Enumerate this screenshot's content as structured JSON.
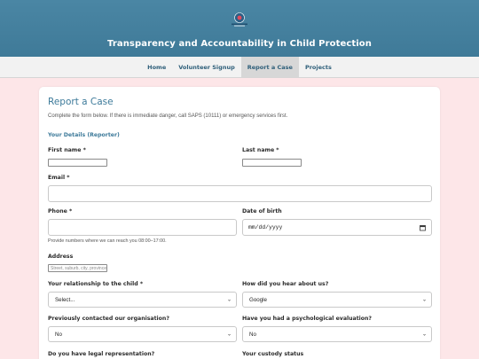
{
  "header": {
    "title": "Transparency and Accountability in Child Protection",
    "logo_icon": "organisation-logo"
  },
  "nav": {
    "items": [
      {
        "label": "Home",
        "active": false
      },
      {
        "label": "Volunteer Signup",
        "active": false
      },
      {
        "label": "Report a Case",
        "active": true
      },
      {
        "label": "Projects",
        "active": false
      }
    ]
  },
  "form": {
    "title": "Report a Case",
    "intro": "Complete the form below. If there is immediate danger, call SAPS (10111) or emergency services first.",
    "section_reporter": "Your Details (Reporter)",
    "first_name_label": "First name *",
    "last_name_label": "Last name *",
    "email_label": "Email *",
    "phone_label": "Phone *",
    "phone_hint": "Provide numbers where we can reach you 08:00–17:00.",
    "dob_label": "Date of birth",
    "dob_placeholder": "mm/dd/yyyy",
    "address_label": "Address",
    "address_placeholder": "Street, suburb, city, province",
    "relationship_label": "Your relationship to the child *",
    "relationship_value": "Select...",
    "heard_label": "How did you hear about us?",
    "heard_value": "Google",
    "contacted_label": "Previously contacted our organisation?",
    "contacted_value": "No",
    "psych_label": "Have you had a psychological evaluation?",
    "psych_value": "No",
    "legal_label": "Do you have legal representation?",
    "custody_label": "Your custody status"
  },
  "colors": {
    "header_bg": "#4582a1",
    "page_bg": "#fde6e8",
    "accent": "#3d7a9a"
  }
}
